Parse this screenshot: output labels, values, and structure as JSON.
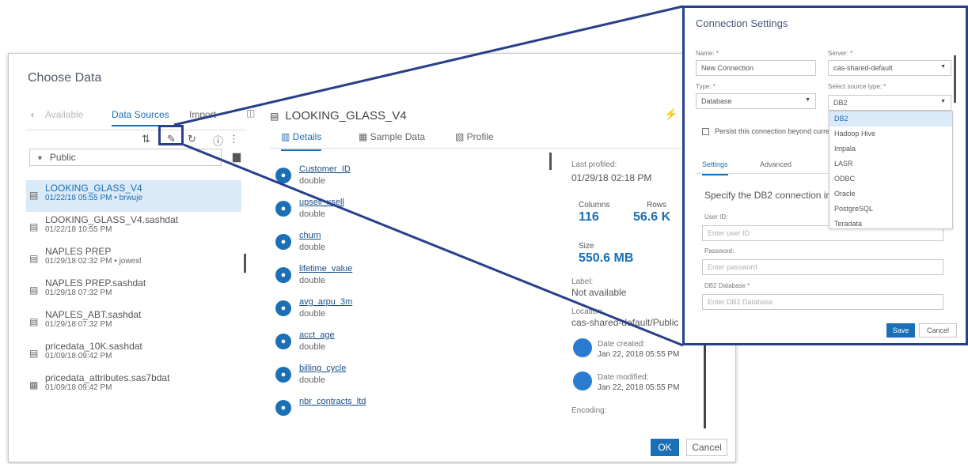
{
  "dialog": {
    "title": "Choose Data",
    "left_tabs": [
      "Available",
      "Data Sources",
      "Import"
    ],
    "library": "Public",
    "tables": [
      {
        "name": "LOOKING_GLASS_V4",
        "sub": "01/22/18 05:55 PM • brwuje"
      },
      {
        "name": "LOOKING_GLASS_V4.sashdat",
        "sub": "01/22/18 10:55 PM"
      },
      {
        "name": "NAPLES PREP",
        "sub": "01/29/18 02:32 PM • jowexl"
      },
      {
        "name": "NAPLES PREP.sashdat",
        "sub": "01/29/18 07:32 PM"
      },
      {
        "name": "NAPLES_ABT.sashdat",
        "sub": "01/29/18 07:32 PM"
      },
      {
        "name": "pricedata_10K.sashdat",
        "sub": "01/09/18 09:42 PM"
      },
      {
        "name": "pricedata_attributes.sas7bdat",
        "sub": "01/09/18 09:42 PM"
      }
    ],
    "selected_table": "LOOKING_GLASS_V4",
    "center_tabs": [
      "Details",
      "Sample Data",
      "Profile"
    ],
    "columns": [
      {
        "name": "Customer_ID",
        "type": "double"
      },
      {
        "name": "upsell_xsell",
        "type": "double"
      },
      {
        "name": "churn",
        "type": "double"
      },
      {
        "name": "lifetime_value",
        "type": "double"
      },
      {
        "name": "avg_arpu_3m",
        "type": "double"
      },
      {
        "name": "acct_age",
        "type": "double"
      },
      {
        "name": "billing_cycle",
        "type": "double"
      },
      {
        "name": "nbr_contracts_ltd",
        "type": ""
      }
    ],
    "details": {
      "last_profiled_label": "Last profiled:",
      "last_profiled": "01/29/18 02:18 PM",
      "columns_label": "Columns",
      "columns": "116",
      "rows_label": "Rows",
      "rows": "56.6 K",
      "size_label": "Size",
      "size": "550.6 MB",
      "label_label": "Label:",
      "label": "Not available",
      "location_label": "Location:",
      "location": "cas-shared-default/Public",
      "created_label": "Date created:",
      "created": "Jan 22, 2018 05:55 PM",
      "modified_label": "Date modified:",
      "modified": "Jan 22, 2018 05:55 PM",
      "encoding_label": "Encoding:"
    },
    "ok": "OK",
    "cancel": "Cancel"
  },
  "connection": {
    "title": "Connection Settings",
    "name_label": "Name: *",
    "name_value": "New Connection",
    "server_label": "Server: *",
    "server_value": "cas-shared-default",
    "type_label": "Type: *",
    "type_value": "Database",
    "source_label": "Select source type: *",
    "source_value": "DB2",
    "persist_label": "Persist this connection beyond current session",
    "tabs": [
      "Settings",
      "Advanced"
    ],
    "specify_text": "Specify the DB2 connection information",
    "user_label": "User ID:",
    "user_placeholder": "Enter user ID",
    "password_label": "Password:",
    "password_placeholder": "Enter password",
    "db_label": "DB2 Database *",
    "db_placeholder": "Enter DB2 Database",
    "source_options": [
      "DB2",
      "Hadoop Hive",
      "Impala",
      "LASR",
      "ODBC",
      "Oracle",
      "PostgreSQL",
      "Teradata"
    ],
    "save": "Save",
    "cancel": "Cancel"
  }
}
